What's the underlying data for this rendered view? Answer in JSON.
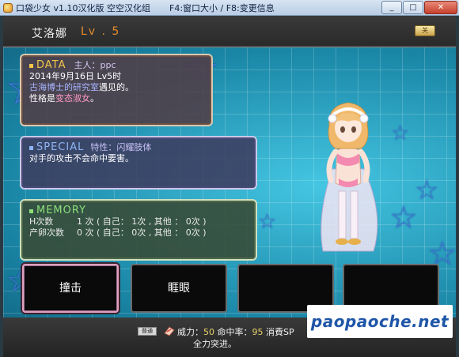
{
  "window": {
    "title": "口袋少女 v1.10汉化版  空空汉化组",
    "hint": "F4:窗口大小 / F8:变更信息",
    "controls": [
      "minimize-icon",
      "maximize-icon",
      "close-icon"
    ]
  },
  "character": {
    "name": "艾洛娜",
    "level": "Lv . 5",
    "close_label": "关"
  },
  "data_panel": {
    "title": "DATA",
    "owner": "主人：ppc",
    "line1": "2014年9月16日  Lv5时",
    "line2_place": "古海博士的研究室",
    "line2_rest": "遇见的。",
    "line3_prefix": "性格是",
    "line3_value": "变态淑女",
    "line3_suffix": "。"
  },
  "special_panel": {
    "title": "SPECIAL",
    "trait": "特性：闪耀肢体",
    "desc": "对手的攻击不会命中要害。"
  },
  "memory_panel": {
    "title": "MEMORY",
    "rows": [
      {
        "label": "H次数",
        "value": "1 次  ( 自己： 1次 , 其他 ： 0次 )"
      },
      {
        "label": "产卵次数",
        "value": "0 次  ( 自己： 0次 , 其他 ： 0次 )"
      }
    ]
  },
  "actions": [
    {
      "label": "撞击"
    },
    {
      "label": "睚眼"
    },
    {
      "label": ""
    },
    {
      "label": ""
    }
  ],
  "skill": {
    "tag": "普通",
    "power_label": "威力：",
    "power": "50",
    "accuracy_label": "命中率：",
    "accuracy": "95",
    "sp_label": "消費SP",
    "desc": "全力突进。"
  },
  "watermark": "paopaoche.net",
  "colors": {
    "level": "#e58a2a",
    "data_title": "#f3c54a",
    "special_title": "#8fb4f4",
    "memory_title": "#8be07a",
    "grid_bg": "#1f9ab8",
    "watermark_text": "#1f56a8"
  }
}
